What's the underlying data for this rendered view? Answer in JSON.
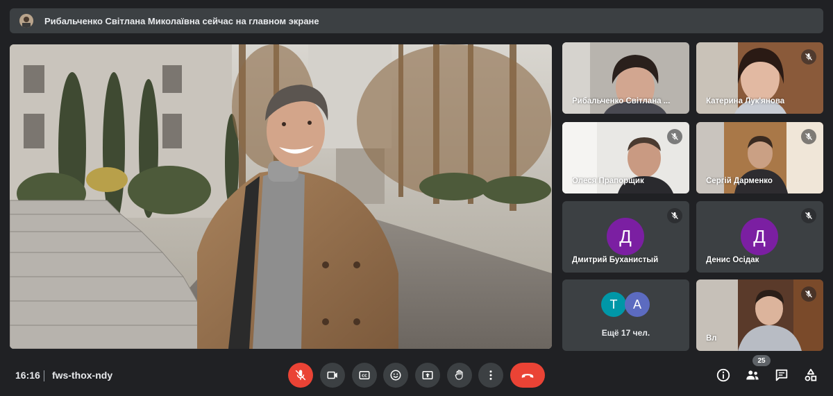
{
  "banner": {
    "text": "Рибальченко Світлана Миколаївна сейчас на главном экране",
    "avatar_icon": "presenter-avatar"
  },
  "tiles": [
    {
      "name": "Рибальченко Світлана ...",
      "muted": false
    },
    {
      "name": "Катерина Лук'янова",
      "muted": true
    },
    {
      "name": "Олеся Прапорщик",
      "muted": true
    },
    {
      "name": "Сергій Дарменко",
      "muted": true
    },
    {
      "name": "Дмитрий Буханистый",
      "muted": true,
      "initial": "Д"
    },
    {
      "name": "Денис Осідак",
      "muted": true,
      "initial": "Д"
    },
    {
      "name": "Вл",
      "muted": true
    }
  ],
  "more": {
    "avatars": [
      {
        "letter": "Т",
        "color": "#0097a7"
      },
      {
        "letter": "А",
        "color": "#5c6bc0"
      }
    ],
    "label": "Ещё 17 чел."
  },
  "bottombar": {
    "time": "16:16",
    "meeting_code": "fws-thox-ndy",
    "participants_count": "25"
  },
  "colors": {
    "background": "#202124",
    "tile": "#3c4043",
    "danger": "#ea4335",
    "avatar_purple": "#7b1fa2"
  }
}
